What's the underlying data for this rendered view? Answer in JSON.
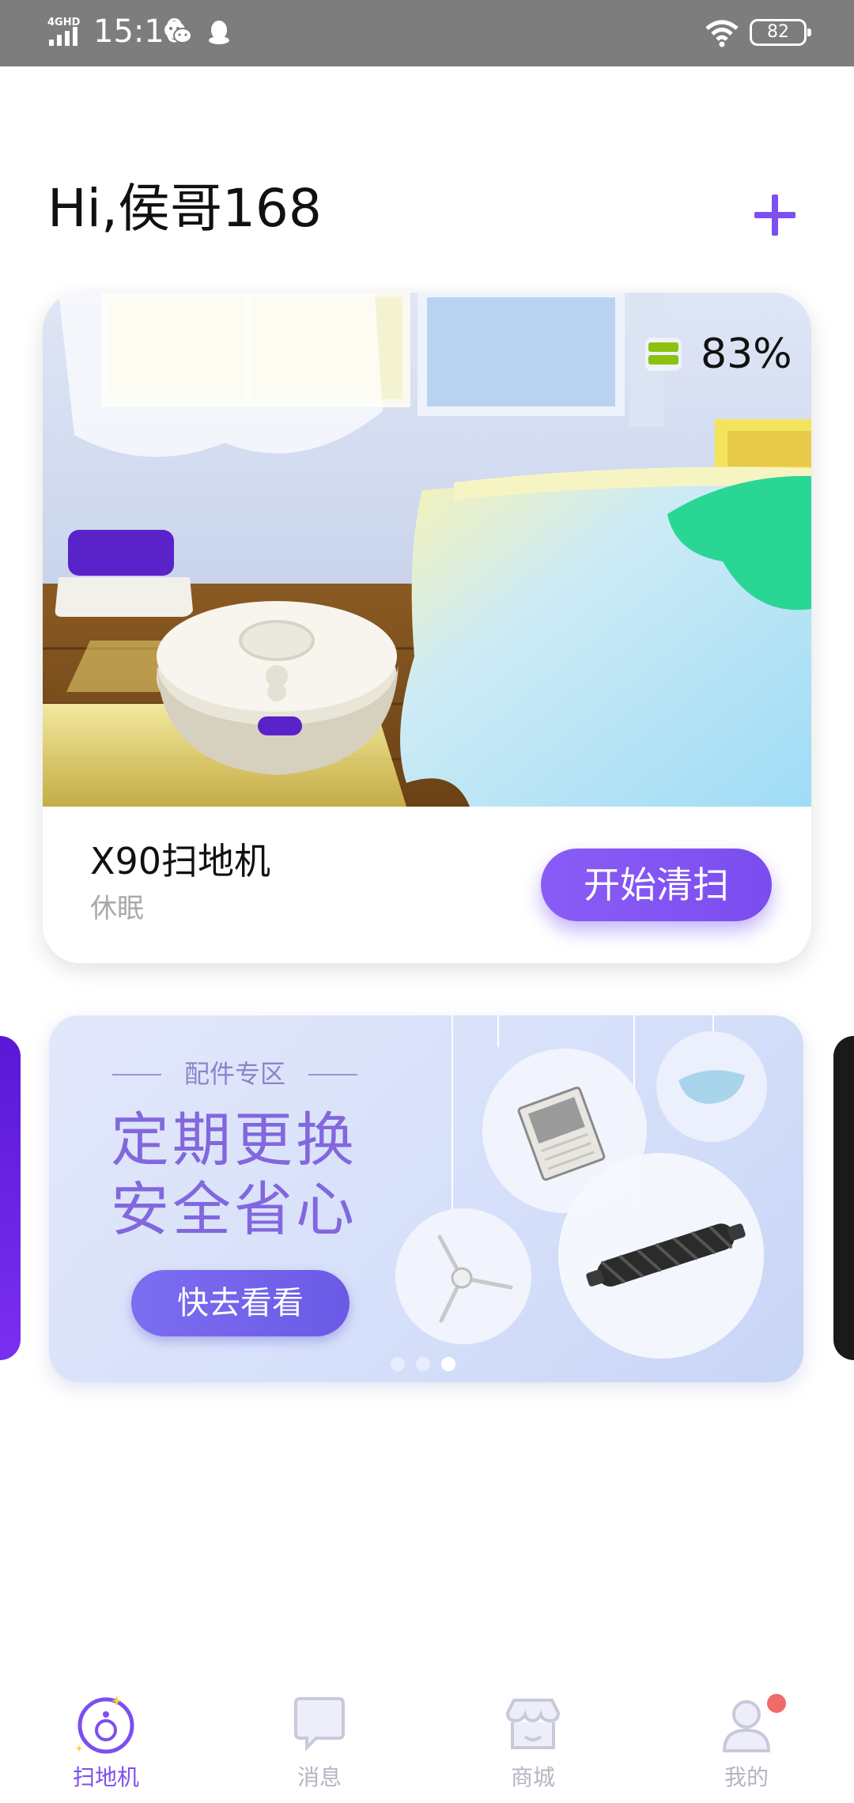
{
  "status_bar": {
    "network": "4GHD",
    "time": "15:10",
    "battery": "82",
    "icons": [
      "signal-icon",
      "wechat-icon",
      "qq-icon",
      "wifi-icon",
      "battery-icon"
    ]
  },
  "header": {
    "greeting": "Hi,侯哥168",
    "add_icon": "plus-icon",
    "accent_color": "#7c4ff0"
  },
  "device": {
    "name": "X90扫地机",
    "status": "休眠",
    "battery_percent": "83%",
    "battery_level": 0.83,
    "start_label": "开始清扫",
    "scene_icon": "robot-vacuum-room-illustration"
  },
  "banner": {
    "kicker": "配件专区",
    "line1": "定期更换",
    "line2": "安全省心",
    "button_label": "快去看看",
    "page_count": 3,
    "active_page": 3,
    "items": [
      "hepa-filter-icon",
      "mop-pad-icon",
      "side-brush-icon",
      "main-brush-icon"
    ]
  },
  "tabs": [
    {
      "label": "扫地机",
      "icon": "robot-icon",
      "active": true
    },
    {
      "label": "消息",
      "icon": "message-icon",
      "active": false
    },
    {
      "label": "商城",
      "icon": "store-icon",
      "active": false
    },
    {
      "label": "我的",
      "icon": "profile-icon",
      "active": false,
      "badge": true
    }
  ]
}
